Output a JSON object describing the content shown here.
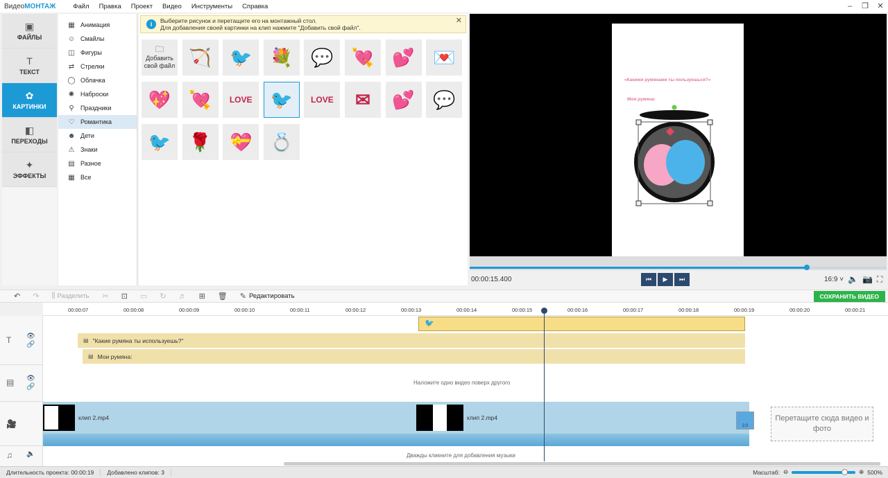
{
  "app": {
    "logo_prefix": "Видео",
    "logo_brand": "МОНТАЖ"
  },
  "menu": [
    "Файл",
    "Правка",
    "Проект",
    "Видео",
    "Инструменты",
    "Справка"
  ],
  "window_controls": [
    "–",
    "❐",
    "✕"
  ],
  "nav": [
    {
      "label": "ФАЙЛЫ",
      "icon": "▣"
    },
    {
      "label": "ТЕКСТ",
      "icon": "T"
    },
    {
      "label": "КАРТИНКИ",
      "icon": "✿"
    },
    {
      "label": "ПЕРЕХОДЫ",
      "icon": "◧"
    },
    {
      "label": "ЭФФЕКТЫ",
      "icon": "✦"
    }
  ],
  "categories": [
    {
      "label": "Анимация",
      "icon": "▦"
    },
    {
      "label": "Смайлы",
      "icon": "☺"
    },
    {
      "label": "Фигуры",
      "icon": "◫"
    },
    {
      "label": "Стрелки",
      "icon": "⇄"
    },
    {
      "label": "Облачка",
      "icon": "◯"
    },
    {
      "label": "Наброски",
      "icon": "✺"
    },
    {
      "label": "Праздники",
      "icon": "⚲"
    },
    {
      "label": "Романтика",
      "icon": "♡"
    },
    {
      "label": "Дети",
      "icon": "☻"
    },
    {
      "label": "Знаки",
      "icon": "⚠"
    },
    {
      "label": "Разное",
      "icon": "▤"
    },
    {
      "label": "Все",
      "icon": "▦"
    }
  ],
  "info": {
    "line1": "Выберите рисунок и перетащите его на монтажный стол.",
    "line2": "Для добавления своей картинки на клип нажмите \"Добавить свой файл\".",
    "close": "✕"
  },
  "add_tile": {
    "line1": "Добавить",
    "line2": "свой файл"
  },
  "stickers": [
    "🏹",
    "🐦",
    "💐",
    "💬",
    "💘",
    "💕",
    "💌",
    "💖",
    "💘",
    "LOVE",
    "🐦",
    "LOVE",
    "✉",
    "💕",
    "💬",
    "🐦",
    "🌹",
    "💝",
    "💍"
  ],
  "preview": {
    "text1": "«Какими румянами ты пользуешься?»",
    "text2": "Мои румяна:"
  },
  "player": {
    "timecode": "00:00:15.400",
    "aspect": "16:9",
    "progress_pct": 81
  },
  "transport": [
    "⏮",
    "▶",
    "⏭"
  ],
  "toolbar": {
    "split": "Разделить",
    "edit": "Редактировать",
    "save": "СОХРАНИТЬ ВИДЕО"
  },
  "ruler": [
    "00:00:07",
    "00:00:08",
    "00:00:09",
    "00:00:10",
    "00:00:11",
    "00:00:12",
    "00:00:13",
    "00:00:14",
    "00:00:15",
    "00:00:16",
    "00:00:17",
    "00:00:18",
    "00:00:19",
    "00:00:20",
    "00:00:21"
  ],
  "timeline": {
    "text_clip1": "\"Какие румяна ты используешь?\"",
    "text_clip2": "Мои румяна:",
    "overlay_hint": "Наложите одно видео поверх другого",
    "clip1": "клип 2.mp4",
    "clip2": "клип 2.mp4",
    "drop": "Перетащите сюда видео и фото",
    "music_hint": "Дважды кликните для добавления музыки",
    "transition_badge": "2.0"
  },
  "status": {
    "duration_label": "Длительность проекта:",
    "duration": "00:00:19",
    "clips_label": "Добавлено клипов:",
    "clips": "3",
    "zoom_label": "Масштаб:",
    "zoom": "500%"
  }
}
